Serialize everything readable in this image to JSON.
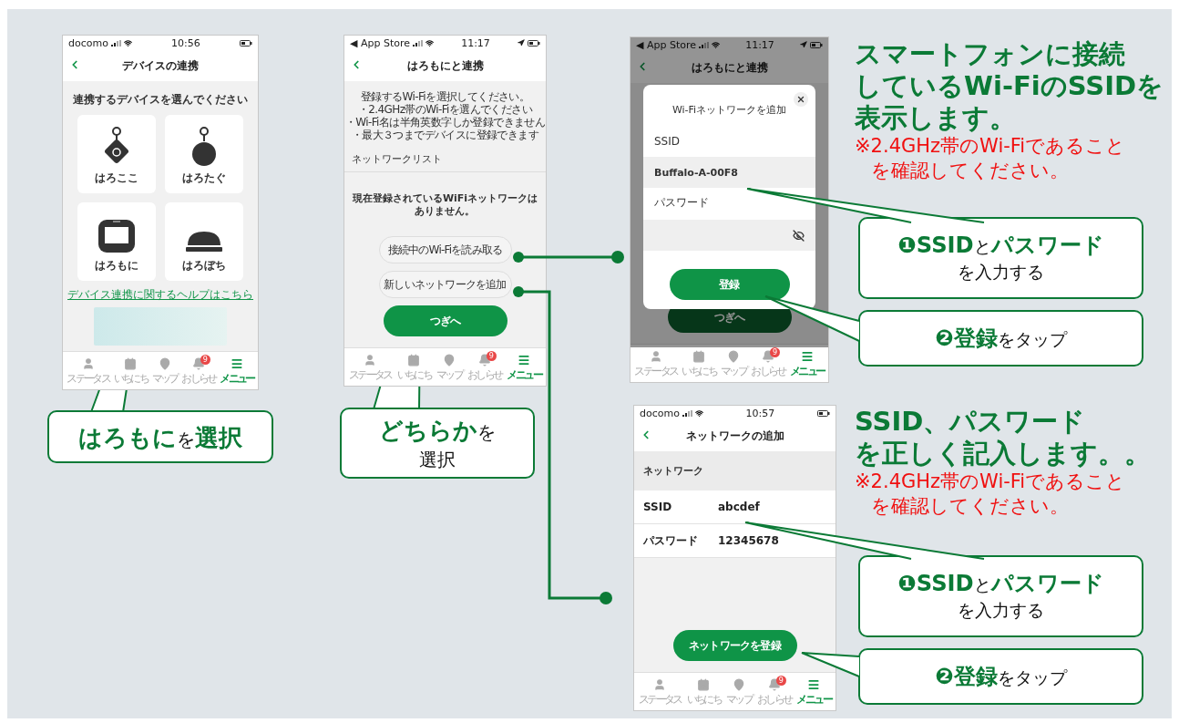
{
  "phones": [
    {
      "kind": "devices",
      "status": {
        "carrier": "docomo",
        "time": "10:56",
        "location": false
      },
      "title": "デバイスの連携",
      "prompt": "連携するデバイスを選んでください",
      "devices": [
        {
          "label": "はろここ",
          "kind": "diamond-tag"
        },
        {
          "label": "はろたぐ",
          "kind": "round-tag"
        },
        {
          "label": "はろもに",
          "kind": "monitor"
        },
        {
          "label": "はろぼち",
          "kind": "pad"
        }
      ],
      "help_link": "デバイス連携に関するヘルプはこちら",
      "tabs": [
        {
          "label": "ステータス",
          "kind": "person",
          "selected": false
        },
        {
          "label": "いちにち",
          "kind": "calendar",
          "selected": false
        },
        {
          "label": "マップ",
          "kind": "pin",
          "selected": false
        },
        {
          "label": "おしらせ",
          "kind": "bell",
          "selected": false,
          "badge": "9"
        },
        {
          "label": "メニュー",
          "kind": "menu",
          "selected": true
        }
      ]
    },
    {
      "kind": "wifi-list",
      "status": {
        "carrier": "◀ App Store",
        "time": "11:17",
        "location": true
      },
      "title": "はろもにと連携",
      "instructions": [
        "登録するWi-Fiを選択してください。",
        "・2.4GHz帯のWi-Fiを選んでください",
        "・Wi-Fi名は半角英数字しか登録できません",
        "・最大３つまでデバイスに登録できます"
      ],
      "section": "ネットワークリスト",
      "empty_lines": [
        "現在登録されているWiFiネットワークは",
        "ありません。"
      ],
      "buttons": [
        {
          "label": "接続中のWi-Fiを読み取る",
          "kind": "outline"
        },
        {
          "label": "新しいネットワークを追加",
          "kind": "outline"
        },
        {
          "label": "つぎへ",
          "kind": "primary"
        }
      ],
      "tabs": [
        {
          "label": "ステータス",
          "kind": "person",
          "selected": false
        },
        {
          "label": "いちにち",
          "kind": "calendar",
          "selected": false
        },
        {
          "label": "マップ",
          "kind": "pin",
          "selected": false
        },
        {
          "label": "おしらせ",
          "kind": "bell",
          "selected": false,
          "badge": "9"
        },
        {
          "label": "メニュー",
          "kind": "menu",
          "selected": true
        }
      ]
    },
    {
      "kind": "wifi-dialog",
      "status": {
        "carrier": "◀ App Store",
        "time": "11:17",
        "location": true
      },
      "title": "はろもにと連携",
      "dialog": {
        "title": "Wi-Fiネットワークを追加",
        "fields": [
          {
            "label": "SSID",
            "value": "Buffalo-A-00F8",
            "secure": false
          },
          {
            "label": "パスワード",
            "secure": true
          }
        ],
        "submit": "登録"
      },
      "buttons": [
        {
          "label": "つぎへ",
          "kind": "primary"
        }
      ],
      "tabs": [
        {
          "label": "ステータス",
          "kind": "person",
          "selected": false
        },
        {
          "label": "いちにち",
          "kind": "calendar",
          "selected": false
        },
        {
          "label": "マップ",
          "kind": "pin",
          "selected": false
        },
        {
          "label": "おしらせ",
          "kind": "bell",
          "selected": false,
          "badge": "9"
        },
        {
          "label": "メニュー",
          "kind": "menu",
          "selected": true
        }
      ]
    },
    {
      "kind": "network-form",
      "status": {
        "carrier": "docomo",
        "time": "10:57",
        "location": false
      },
      "title": "ネットワークの追加",
      "section": "ネットワーク",
      "rows": [
        {
          "label": "SSID",
          "value": "abcdef"
        },
        {
          "label": "パスワード",
          "value": "12345678"
        }
      ],
      "buttons": [
        {
          "label": "ネットワークを登録",
          "kind": "primary"
        }
      ],
      "tabs": [
        {
          "label": "ステータス",
          "kind": "person",
          "selected": false
        },
        {
          "label": "いちにち",
          "kind": "calendar",
          "selected": false
        },
        {
          "label": "マップ",
          "kind": "pin",
          "selected": false
        },
        {
          "label": "おしらせ",
          "kind": "bell",
          "selected": false,
          "badge": "9"
        },
        {
          "label": "メニュー",
          "kind": "menu",
          "selected": true
        }
      ]
    }
  ],
  "callouts": [
    {
      "lines": [
        [
          {
            "text": "はろもに",
            "emph": true
          },
          {
            "text": "を",
            "emph": false
          },
          {
            "text": "選択",
            "emph": true
          }
        ]
      ]
    },
    {
      "lines": [
        [
          {
            "text": "どちらか",
            "emph": true
          },
          {
            "text": "を",
            "emph": false
          }
        ],
        [
          {
            "text": "選択",
            "emph": false
          }
        ]
      ]
    }
  ],
  "notes": [
    {
      "heading_lines": [
        "スマートフォンに接続",
        "しているWi-FiのSSIDを",
        "表示します。"
      ],
      "warning_lines": [
        "※2.4GHz帯のWi-Fiであること",
        "を確認してください。"
      ],
      "steps": [
        {
          "number": "❶",
          "lines": [
            [
              {
                "text": "SSID",
                "emph": true
              },
              {
                "text": "と",
                "emph": false
              },
              {
                "text": "パスワード",
                "emph": true
              }
            ],
            [
              {
                "text": "を入力する",
                "emph": false
              }
            ]
          ]
        },
        {
          "number": "❷",
          "lines": [
            [
              {
                "text": "登録",
                "emph": true
              },
              {
                "text": "をタップ",
                "emph": false
              }
            ]
          ]
        }
      ]
    },
    {
      "heading_lines": [
        "SSID、パスワード",
        "を正しく記入します。。"
      ],
      "warning_lines": [
        "※2.4GHz帯のWi-Fiであること",
        "を確認してください。"
      ],
      "steps": [
        {
          "number": "❶",
          "lines": [
            [
              {
                "text": "SSID",
                "emph": true
              },
              {
                "text": "と",
                "emph": false
              },
              {
                "text": "パスワード",
                "emph": true
              }
            ],
            [
              {
                "text": "を入力する",
                "emph": false
              }
            ]
          ]
        },
        {
          "number": "❷",
          "lines": [
            [
              {
                "text": "登録",
                "emph": true
              },
              {
                "text": "をタップ",
                "emph": false
              }
            ]
          ]
        }
      ]
    }
  ]
}
